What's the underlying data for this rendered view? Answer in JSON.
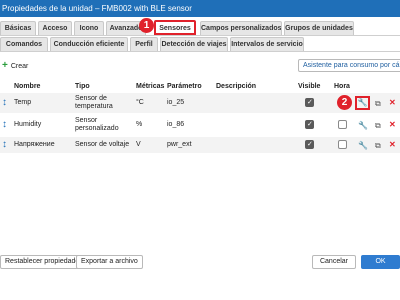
{
  "window": {
    "title": "Propiedades de la unidad – FMB002 with BLE sensor"
  },
  "tabs_row1": [
    {
      "label": "Básicas"
    },
    {
      "label": "Acceso"
    },
    {
      "label": "Icono"
    },
    {
      "label": "Avanzado"
    },
    {
      "label": "Sensores",
      "active": true
    },
    {
      "label": "Campos personalizados"
    },
    {
      "label": "Grupos de unidades"
    }
  ],
  "tabs_row2": [
    {
      "label": "Comandos"
    },
    {
      "label": "Conducción eficiente"
    },
    {
      "label": "Perfil"
    },
    {
      "label": "Detección de viajes"
    },
    {
      "label": "Intervalos de servicio"
    }
  ],
  "callouts": {
    "one": "1",
    "two": "2"
  },
  "toolbar": {
    "create_label": "Crear",
    "assist_label": "Asistente para consumo por cálculo"
  },
  "table": {
    "headers": {
      "name": "Nombre",
      "type": "Tipo",
      "metrics": "Métricas",
      "param": "Parámetro",
      "desc": "Descripción",
      "visible": "Visible",
      "hour": "Hora"
    },
    "rows": [
      {
        "name": "Temp",
        "type": "Sensor de temperatura",
        "metric": "°C",
        "param": "io_25",
        "desc": "",
        "visible": true,
        "hour": false
      },
      {
        "name": "Humidity",
        "type": "Sensor personalizado",
        "metric": "%",
        "param": "io_86",
        "desc": "",
        "visible": true,
        "hour": false
      },
      {
        "name": "Напряжение",
        "type": "Sensor de voltaje",
        "metric": "V",
        "param": "pwr_ext",
        "desc": "",
        "visible": true,
        "hour": false
      }
    ]
  },
  "icons": {
    "sort": "sort-arrows-icon",
    "edit": "wrench-icon",
    "copy": "copy-icon",
    "delete": "close-icon"
  },
  "footer": {
    "reset_label": "Restablecer propiedades",
    "export_label": "Exportar a archivo",
    "cancel_label": "Cancelar",
    "ok_label": "OK"
  },
  "colors": {
    "titlebar": "#1f6fb8",
    "highlight": "#e0212b",
    "ok": "#2f7cd0"
  }
}
